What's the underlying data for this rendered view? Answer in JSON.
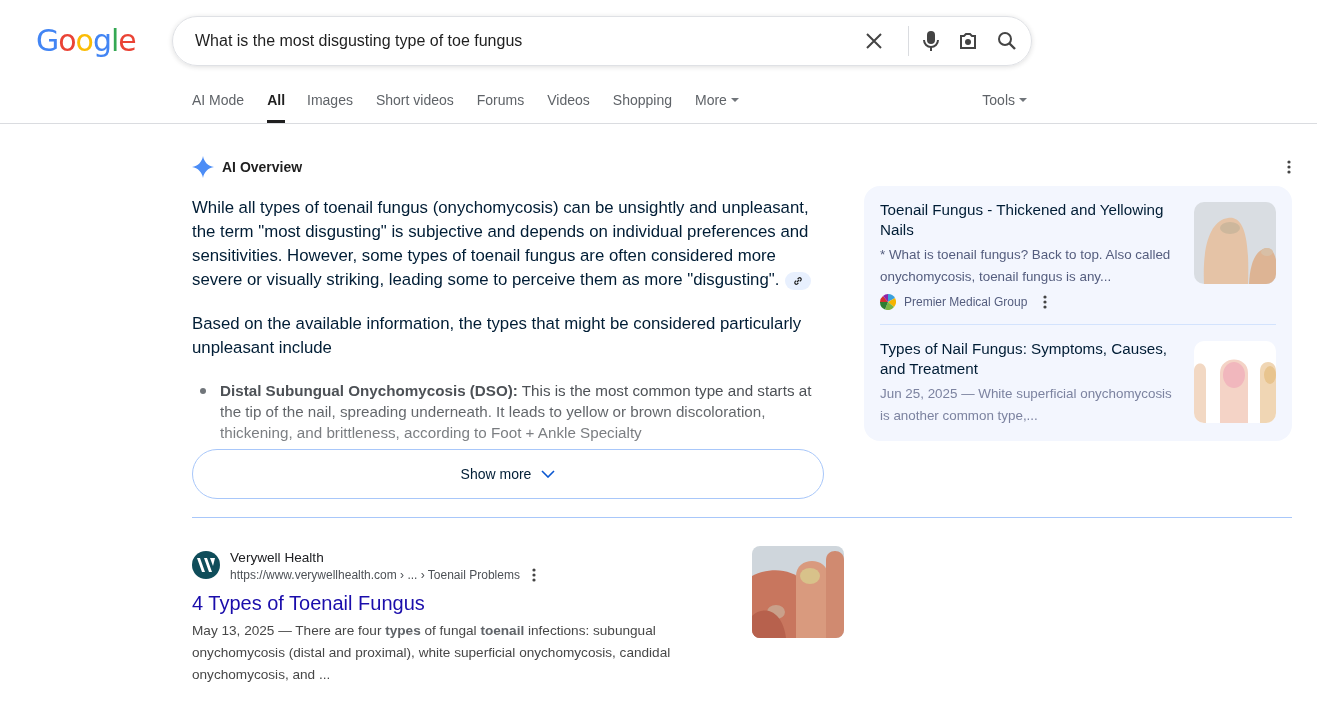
{
  "logo": "Google",
  "search": {
    "value": "What is the most disgusting type of toe fungus"
  },
  "tabs": [
    {
      "label": "AI Mode",
      "selected": false
    },
    {
      "label": "All",
      "selected": true
    },
    {
      "label": "Images",
      "selected": false
    },
    {
      "label": "Short videos",
      "selected": false
    },
    {
      "label": "Forums",
      "selected": false
    },
    {
      "label": "Videos",
      "selected": false
    },
    {
      "label": "Shopping",
      "selected": false
    },
    {
      "label": "More",
      "selected": false,
      "kind": "dropdown"
    }
  ],
  "tools": "Tools",
  "ai_overview": {
    "title": "AI Overview",
    "paragraphs": [
      {
        "text": "While all types of toenail fungus (onychomycosis) can be unsightly and unpleasant, the term \"most disgusting\" is subjective and depends on individual preferences and sensitivities. However, some types of toenail fungus are often considered more severe or visually striking, leading some to perceive them as more \"disgusting\".",
        "link_chip": true
      },
      {
        "text": "Based on the available information, the types that might be considered particularly unpleasant include",
        "link_chip": false
      }
    ],
    "bullets": [
      {
        "term": "Distal Subungual Onychomycosis (DSO):",
        "text": "This is the most common type and starts at the tip of the nail, spreading underneath. It leads to yellow or brown discoloration, thickening, and brittleness, according to Foot + Ankle Specialty"
      }
    ],
    "show_more": "Show more",
    "sources": [
      {
        "title": "Toenail Fungus - Thickened and Yellowing Nails",
        "snippet": "* What is toenail fungus? Back to top. Also called onychomycosis, toenail fungus is any...",
        "site": "Premier Medical Group",
        "faded": false
      },
      {
        "title": "Types of Nail Fungus: Symptoms, Causes, and Treatment",
        "snippet": "Jun 25, 2025 — White superficial onychomycosis is another common type,...",
        "faded": true
      }
    ]
  },
  "results": [
    {
      "site": "Verywell Health",
      "url": "https://www.verywellhealth.com › ... › Toenail Problems",
      "title": "4 Types of Toenail Fungus",
      "snippet": "May 13, 2025 — There are four **types** of fungal **toenail** infections: subungual onychomycosis (distal and proximal), white superficial onychomycosis, candidal onychomycosis, and ..."
    }
  ]
}
